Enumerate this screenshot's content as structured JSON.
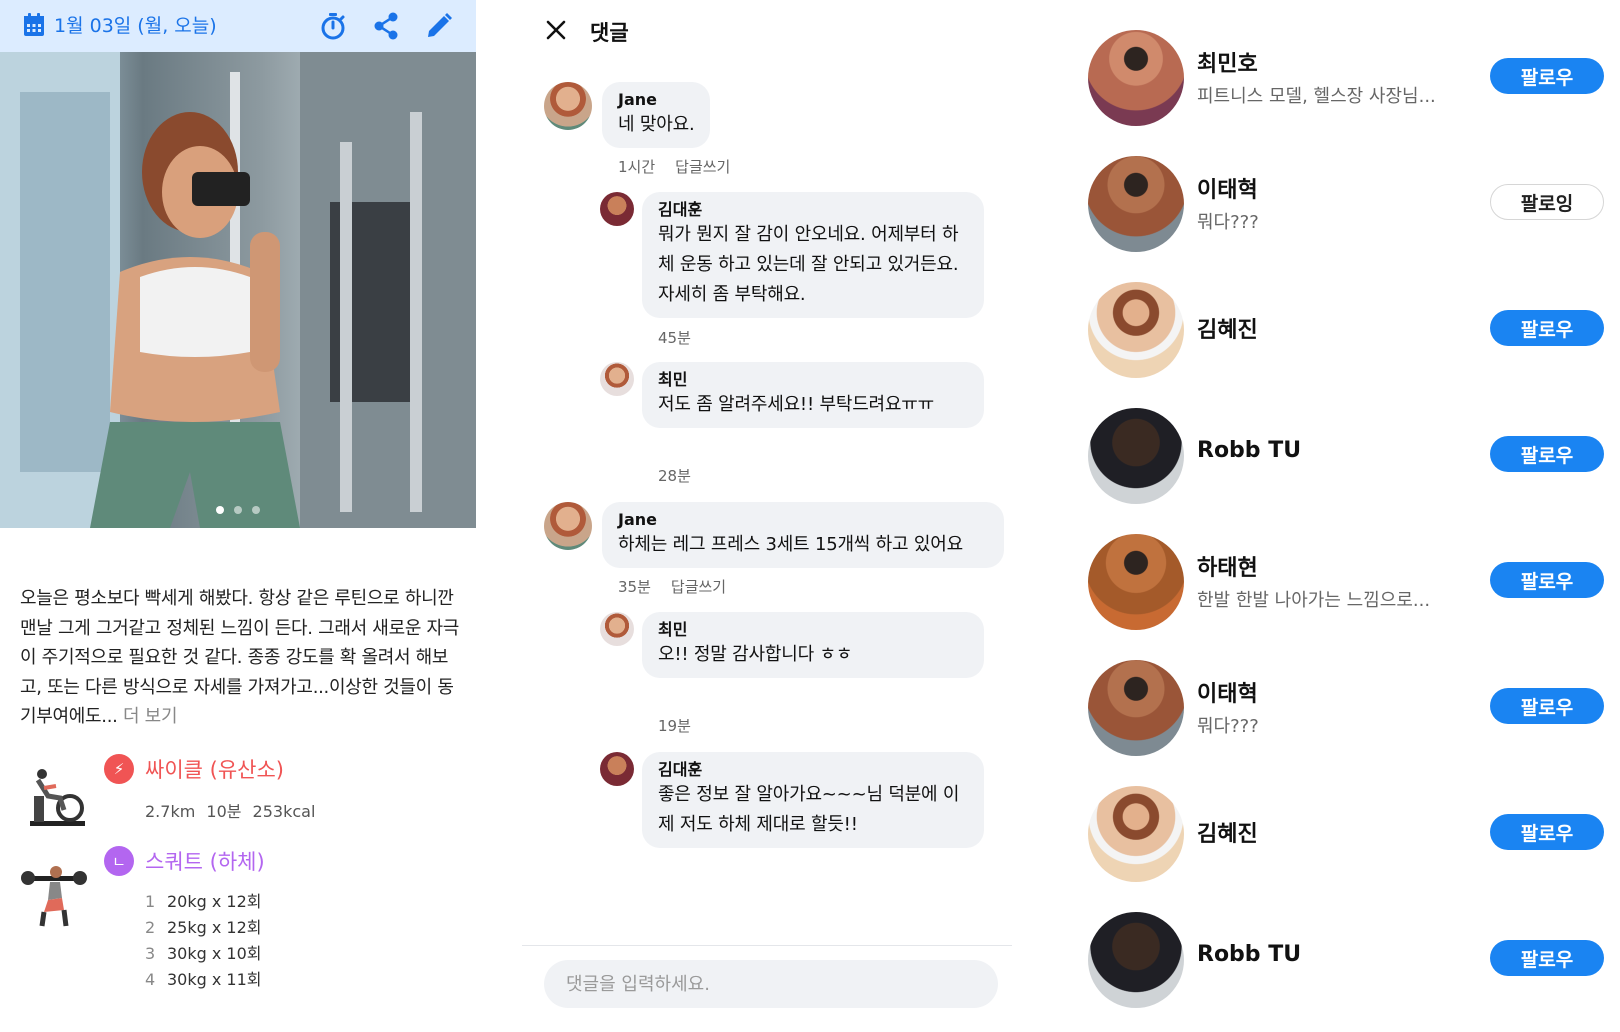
{
  "post": {
    "date": "1월 03일 (월, 오늘)",
    "text": "오늘은 평소보다 빡세게 해봤다. 항상 같은 루틴으로 하니깐 맨날 그게 그거같고 정체된 느낌이 든다. 그래서 새로운 자극이 주기적으로 필요한 것 같다. 종종 강도를 확 올려서 해보고, 또는 다른 방식으로 자세를 가져가고...이상한 것들이 동기부여에도...",
    "more_label": "더 보기",
    "icons": [
      "calendar-icon",
      "timer-icon",
      "share-icon",
      "edit-icon"
    ],
    "carousel": {
      "pages": 3,
      "active": 1
    },
    "exercises": [
      {
        "title": "싸이클 (유산소)",
        "color": "#f05454",
        "meta": "2.7km 10분 253kcal"
      },
      {
        "title": "스쿼트 (하체)",
        "color": "#b366f0",
        "sets": [
          {
            "n": "1",
            "text": "20kg x 12회"
          },
          {
            "n": "2",
            "text": "25kg x 12회"
          },
          {
            "n": "3",
            "text": "30kg x 10회"
          },
          {
            "n": "4",
            "text": "30kg x 11회"
          }
        ]
      }
    ]
  },
  "comments": {
    "title": "댓글",
    "reply_label": "답글쓰기",
    "input_placeholder": "댓글을 입력하세요.",
    "items": [
      {
        "name": "Jane",
        "text": "네 맞아요.",
        "time": "1시간",
        "reply": true
      },
      {
        "name": "김대훈",
        "text": "뭐가 뭔지 잘 감이 안오네요. 어제부터 하체 운동 하고 있는데 잘 안되고 있거든요. 자세히 좀 부탁해요.",
        "time": "45분"
      },
      {
        "name": "최민",
        "text": "저도 좀 알려주세요!! 부탁드려요ㅠㅠ",
        "time": "28분"
      },
      {
        "name": "Jane",
        "text": "하체는 레그 프레스 3세트 15개씩 하고 있어요",
        "time": "35분",
        "reply": true
      },
      {
        "name": "최민",
        "text": "오!! 정말 감사합니다 ㅎㅎ",
        "time": "19분"
      },
      {
        "name": "김대훈",
        "text": "좋은 정보 잘 알아가요~~~님 덕분에 이제 저도 하체 제대로 할듯!!"
      }
    ]
  },
  "follow": {
    "follow_label": "팔로우",
    "following_label": "팔로잉",
    "users": [
      {
        "name": "최민호",
        "desc": "피트니스 모델, 헬스장 사장님...",
        "state": "follow"
      },
      {
        "name": "이태혁",
        "desc": "뭐다???",
        "state": "following"
      },
      {
        "name": "김혜진",
        "desc": "",
        "state": "follow"
      },
      {
        "name": "Robb TU",
        "desc": "",
        "state": "follow"
      },
      {
        "name": "하태현",
        "desc": "한발 한발 나아가는 느낌으로...",
        "state": "follow"
      },
      {
        "name": "이태혁",
        "desc": "뭐다???",
        "state": "follow"
      },
      {
        "name": "김혜진",
        "desc": "",
        "state": "follow"
      },
      {
        "name": "Robb TU",
        "desc": "",
        "state": "follow"
      }
    ]
  }
}
